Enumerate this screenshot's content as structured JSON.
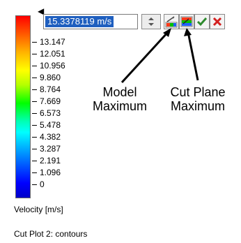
{
  "toolbar": {
    "value": "15.3378119 m/s"
  },
  "legend": {
    "ticks": [
      "13.147",
      "12.051",
      "10.956",
      "9.860",
      "8.764",
      "7.669",
      "6.573",
      "5.478",
      "4.382",
      "3.287",
      "2.191",
      "1.096",
      "0"
    ],
    "unit_label": "Velocity [m/s]"
  },
  "annotations": {
    "model_maximum": [
      "Model",
      "Maximum"
    ],
    "cut_plane_maximum": [
      "Cut Plane",
      "Maximum"
    ]
  },
  "footer": {
    "plot_title": "Cut Plot 2: contours"
  },
  "icons": {
    "model_max": "model-maximum-icon",
    "cut_plane_max": "cut-plane-maximum-icon",
    "ok": "check-icon",
    "cancel": "close-icon"
  },
  "colors": {
    "accent": "#1f5fbf",
    "ok_green": "#2e8b2e",
    "cancel_red": "#d32020"
  }
}
